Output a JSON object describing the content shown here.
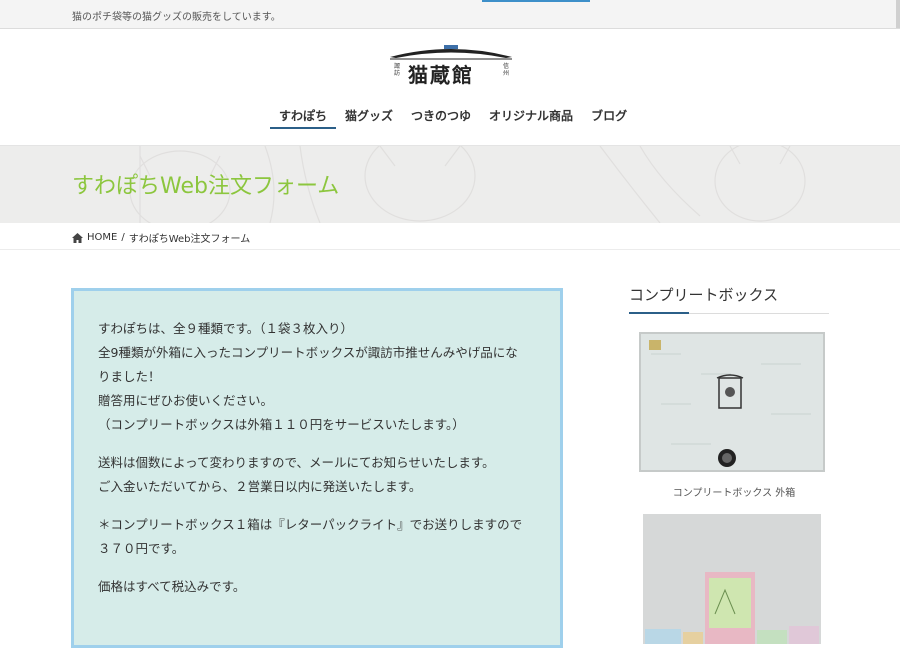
{
  "topbar": {
    "tagline": "猫のポチ袋等の猫グッズの販売をしています。"
  },
  "logo": {
    "main": "猫蔵館",
    "left_text": "諏訪",
    "right_text": "信州"
  },
  "nav": {
    "items": [
      {
        "label": "すわぽち",
        "active": true
      },
      {
        "label": "猫グッズ",
        "active": false
      },
      {
        "label": "つきのつゆ",
        "active": false
      },
      {
        "label": "オリジナル商品",
        "active": false
      },
      {
        "label": "ブログ",
        "active": false
      }
    ]
  },
  "hero": {
    "title": "すわぽちWeb注文フォーム"
  },
  "breadcrumb": {
    "home": "HOME",
    "separator": "/",
    "current": "すわぽちWeb注文フォーム"
  },
  "content": {
    "lines": [
      "すわぽちは、全９種類です。（１袋３枚入り）",
      "全9種類が外箱に入ったコンプリートボックスが諏訪市推せんみやげ品にな",
      "りました！",
      "贈答用にぜひお使いください。",
      "（コンプリートボックスは外箱１１０円をサービスいたします。）",
      "送料は個数によって変わりますので、メールにてお知らせいたします。",
      "ご入金いただいてから、２営業日以内に発送いたします。",
      "＊コンプリートボックス１箱は『レターパックライト』でお送りしますので",
      "３７０円です。",
      "価格はすべて税込みです。"
    ]
  },
  "sidebar": {
    "heading": "コンプリートボックス",
    "caption1": "コンプリートボックス 外箱"
  },
  "colors": {
    "accent_green": "#8cc63e",
    "nav_underline": "#2b5f88",
    "box_bg": "#d6ece9",
    "box_border": "#9fd0ec"
  }
}
